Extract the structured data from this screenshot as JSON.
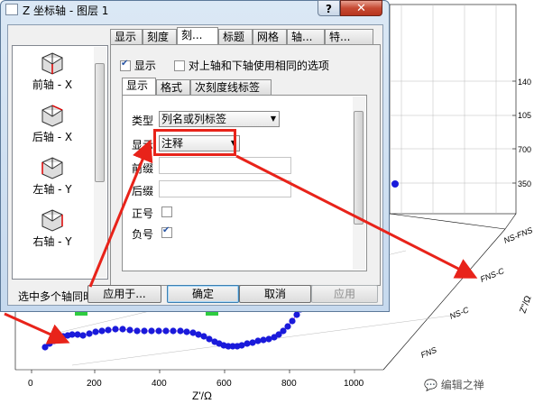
{
  "dialog": {
    "title": "Z 坐标轴 - 图层 1",
    "help": "?",
    "close": "✕",
    "tabs": [
      "显示",
      "刻度",
      "刻...",
      "标题",
      "网格",
      "轴...",
      "特..."
    ],
    "active_tab": 2,
    "axes": [
      {
        "label": "前轴 - X",
        "marker": "1 3"
      },
      {
        "label": "后轴 - X",
        "marker": "1 3"
      },
      {
        "label": "左轴 - Y",
        "marker": "1 3"
      },
      {
        "label": "右轴 - Y",
        "marker": "1 3"
      }
    ],
    "show_checkbox": {
      "label": "显示",
      "checked": true
    },
    "same_options": {
      "label": "对上轴和下轴使用相同的选项",
      "checked": false
    },
    "subtabs": [
      "显示",
      "格式",
      "次刻度线标签"
    ],
    "fields": {
      "type_label": "类型",
      "type_value": "列名或列标签",
      "display_label": "显示",
      "display_value": "注释",
      "prefix_label": "前缀",
      "suffix_label": "后缀",
      "plus_label": "正号",
      "plus_checked": false,
      "minus_label": "负号",
      "minus_checked": true
    },
    "hint": "选中多个轴同时进行修改",
    "buttons": {
      "apply_to": "应用于...",
      "ok": "确定",
      "cancel": "取消",
      "apply": "应用"
    }
  },
  "plot": {
    "xlabel": "Z'/Ω",
    "xticks": [
      "0",
      "200",
      "400",
      "600",
      "800",
      "1000"
    ],
    "right_ticks": [
      "140",
      "105",
      "700",
      "350"
    ],
    "categories": [
      "NS-FNS",
      "FNS-C",
      "NS-C",
      "FNS"
    ],
    "zlabel": "Z\"/Ω",
    "series_color": "#1a1adb",
    "line_color": "#cc33cc",
    "arrow_color": "#e8231a"
  },
  "watermark": "编辑之禅"
}
